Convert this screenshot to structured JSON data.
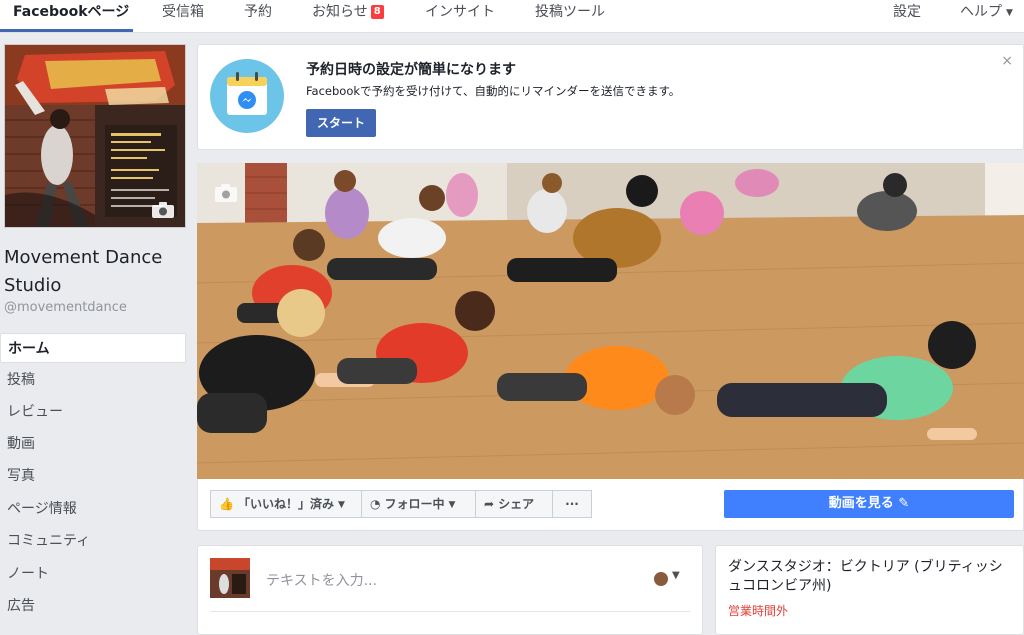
{
  "topnav": {
    "tabs": [
      {
        "label": "Facebookページ"
      },
      {
        "label": "受信箱"
      },
      {
        "label": "予約"
      },
      {
        "label": "お知らせ",
        "badge": "8"
      },
      {
        "label": "インサイト"
      },
      {
        "label": "投稿ツール"
      }
    ],
    "settings": "設定",
    "help": "ヘルプ"
  },
  "page": {
    "name": "Movement Dance Studio",
    "handle": "@movementdance"
  },
  "sidebar": {
    "items": [
      {
        "label": "ホーム"
      },
      {
        "label": "投稿"
      },
      {
        "label": "レビュー"
      },
      {
        "label": "動画"
      },
      {
        "label": "写真"
      },
      {
        "label": "ページ情報"
      },
      {
        "label": "コミュニティ"
      },
      {
        "label": "ノート"
      },
      {
        "label": "広告"
      }
    ]
  },
  "promo": {
    "title": "予約日時の設定が簡単になります",
    "text": "Facebookで予約を受け付けて、自動的にリマインダーを送信できます。",
    "button": "スタート",
    "close": "×"
  },
  "actions": {
    "like": "「いいね！」済み",
    "follow": "フォロー中",
    "share": "シェア",
    "more": "···",
    "watch": "動画を見る"
  },
  "composer": {
    "placeholder": "テキストを入力..."
  },
  "info": {
    "title": "ダンススタジオ：ビクトリア (ブリティッシュコロンビア州)",
    "status": "営業時間外"
  },
  "colors": {
    "brand": "#4267b2",
    "watch": "#4080ff",
    "badge": "#fa3e3e",
    "closed": "#e04038"
  }
}
